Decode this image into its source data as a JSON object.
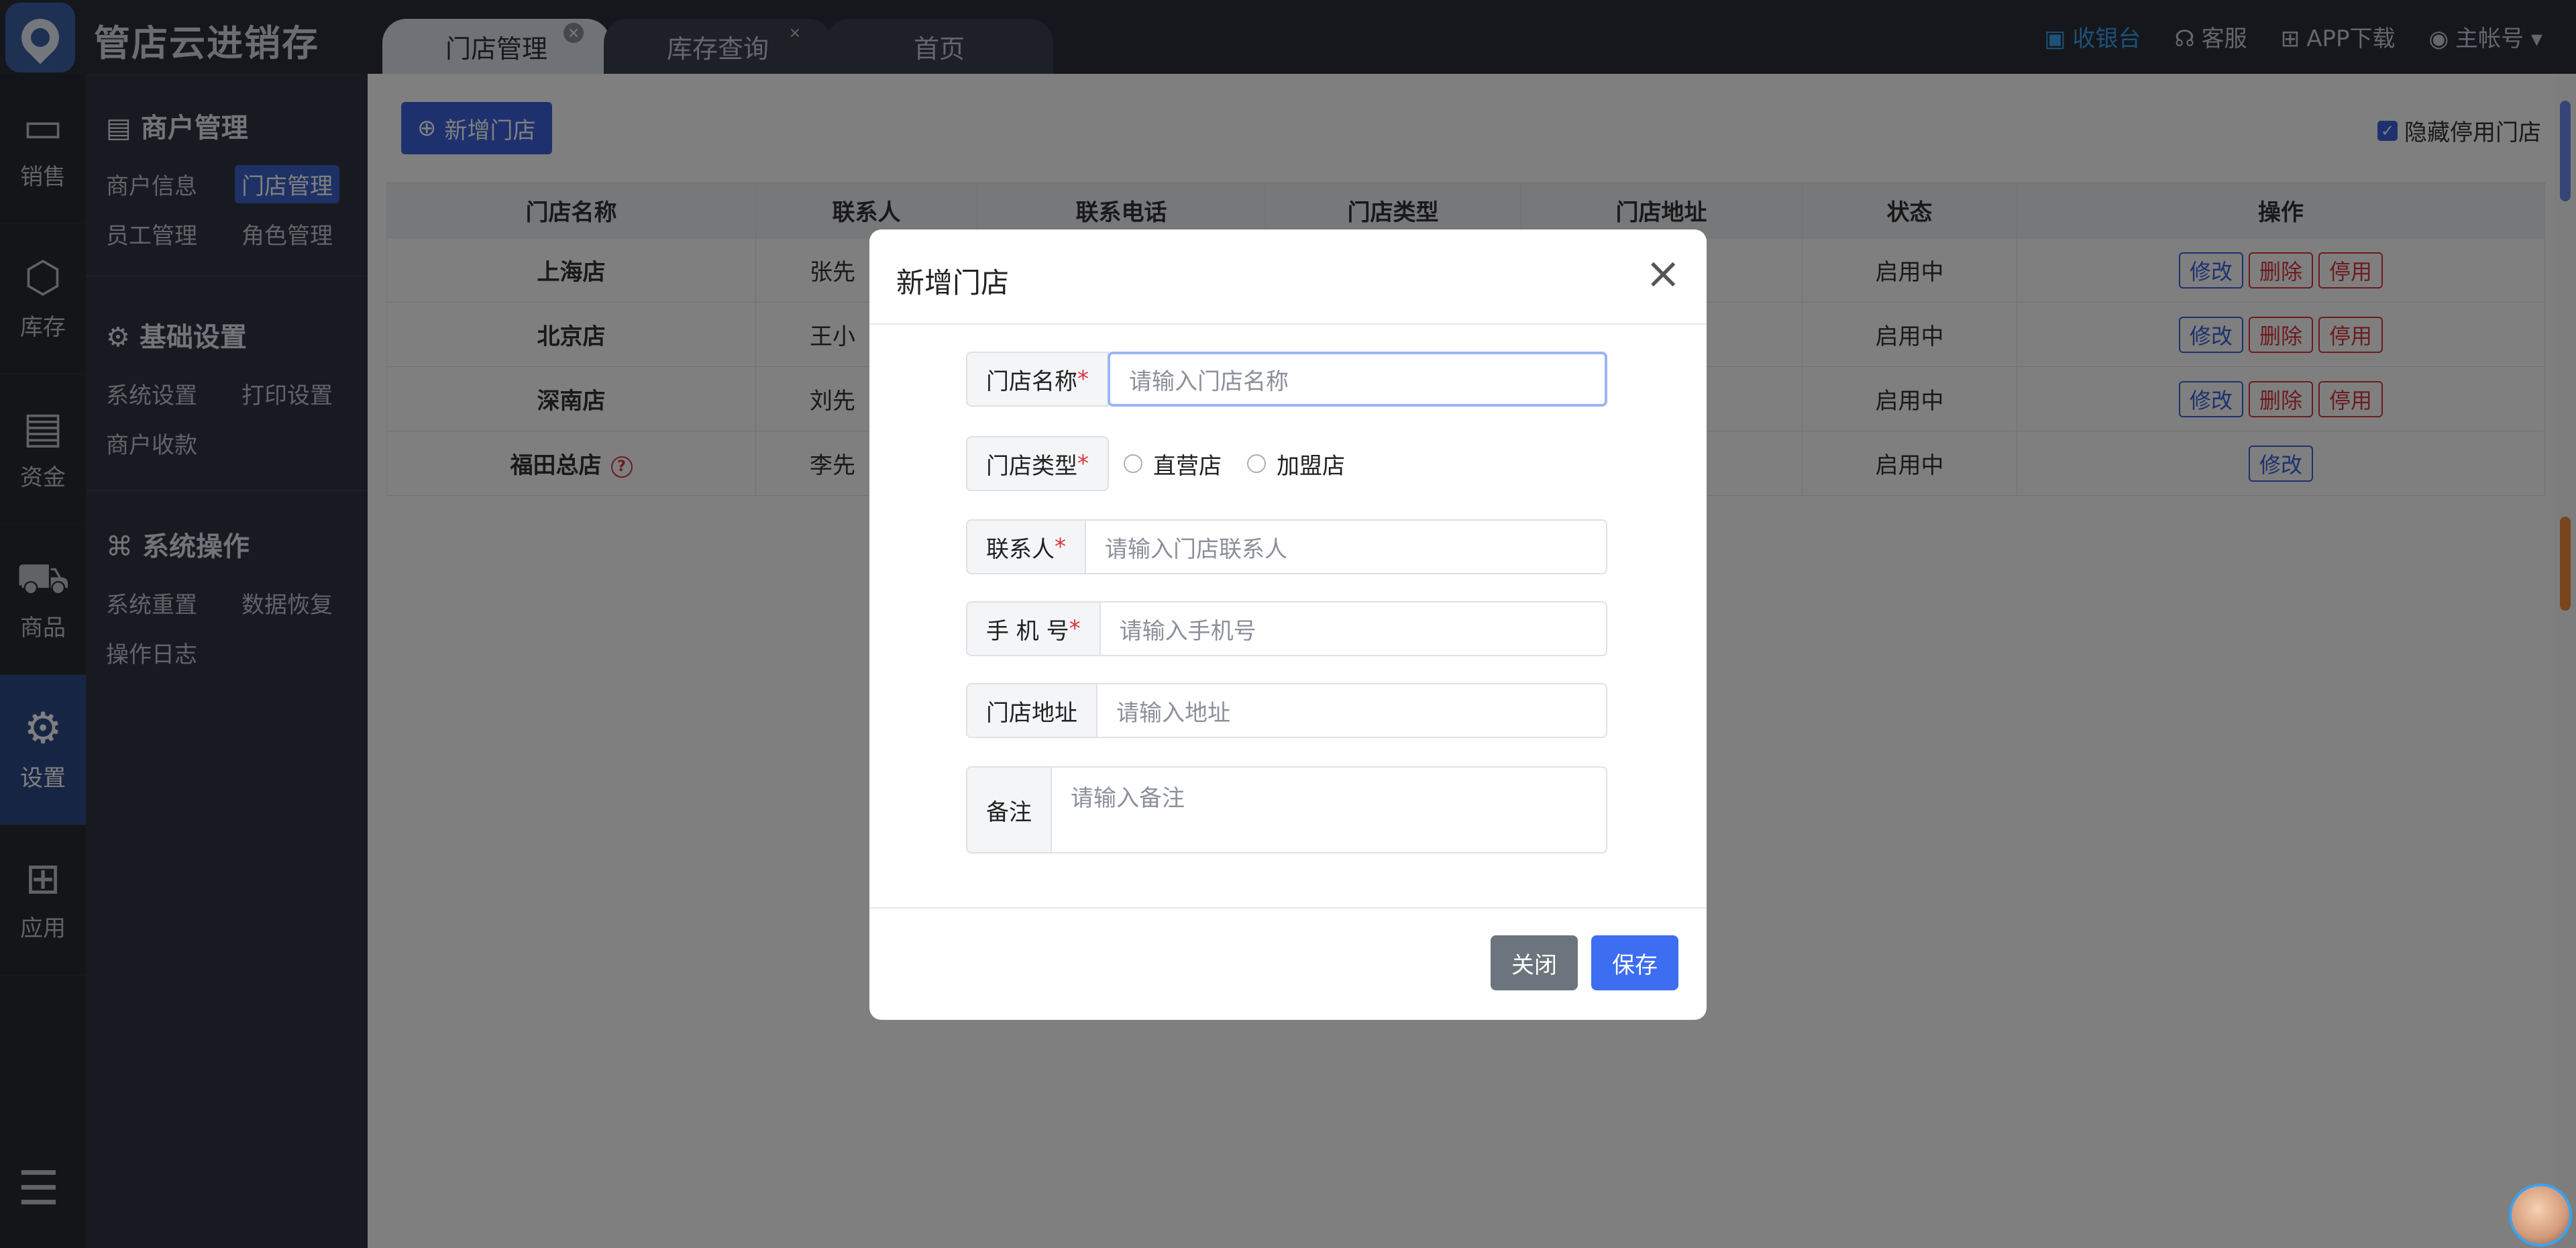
{
  "app": {
    "title": "管店云进销存"
  },
  "tabs": [
    {
      "label": "门店管理"
    },
    {
      "label": "库存查询"
    },
    {
      "label": "首页"
    }
  ],
  "topbar": {
    "cashier": "收银台",
    "service": "客服",
    "app_download": "APP下载",
    "account": "主帐号"
  },
  "rail": [
    {
      "label": "销售",
      "icon": "sales-icon"
    },
    {
      "label": "库存",
      "icon": "box-icon"
    },
    {
      "label": "资金",
      "icon": "card-icon"
    },
    {
      "label": "商品",
      "icon": "cart-icon"
    },
    {
      "label": "设置",
      "icon": "gear-icon"
    },
    {
      "label": "应用",
      "icon": "apps-icon"
    }
  ],
  "subnav": {
    "merchant": {
      "title": "商户管理",
      "items": [
        "商户信息",
        "门店管理",
        "员工管理",
        "角色管理"
      ]
    },
    "basic": {
      "title": "基础设置",
      "items": [
        "系统设置",
        "打印设置",
        "商户收款"
      ]
    },
    "system": {
      "title": "系统操作",
      "items": [
        "系统重置",
        "数据恢复",
        "操作日志"
      ]
    }
  },
  "main": {
    "add_button": "新增门店",
    "hide_disabled": "隐藏停用门店",
    "columns": [
      "门店名称",
      "联系人",
      "联系电话",
      "门店类型",
      "门店地址",
      "状态",
      "操作"
    ],
    "rows": [
      {
        "name": "上海店",
        "contact": "张先",
        "status": "启用中",
        "ops": [
          "修改",
          "删除",
          "停用"
        ]
      },
      {
        "name": "北京店",
        "contact": "王小",
        "status": "启用中",
        "ops": [
          "修改",
          "删除",
          "停用"
        ]
      },
      {
        "name": "深南店",
        "contact": "刘先",
        "status": "启用中",
        "ops": [
          "修改",
          "删除",
          "停用"
        ]
      },
      {
        "name": "福田总店",
        "contact": "李先",
        "status": "启用中",
        "ops": [
          "修改"
        ]
      }
    ]
  },
  "modal": {
    "title": "新增门店",
    "fields": {
      "store_name": {
        "label": "门店名称",
        "placeholder": "请输入门店名称"
      },
      "store_type": {
        "label": "门店类型",
        "options": [
          "直营店",
          "加盟店"
        ]
      },
      "contact": {
        "label": "联系人",
        "placeholder": "请输入门店联系人"
      },
      "phone": {
        "label": "手 机 号",
        "placeholder": "请输入手机号"
      },
      "address": {
        "label": "门店地址",
        "placeholder": "请输入地址"
      },
      "note": {
        "label": "备注",
        "placeholder": "请输入备注"
      }
    },
    "close_button": "关闭",
    "save_button": "保存"
  }
}
